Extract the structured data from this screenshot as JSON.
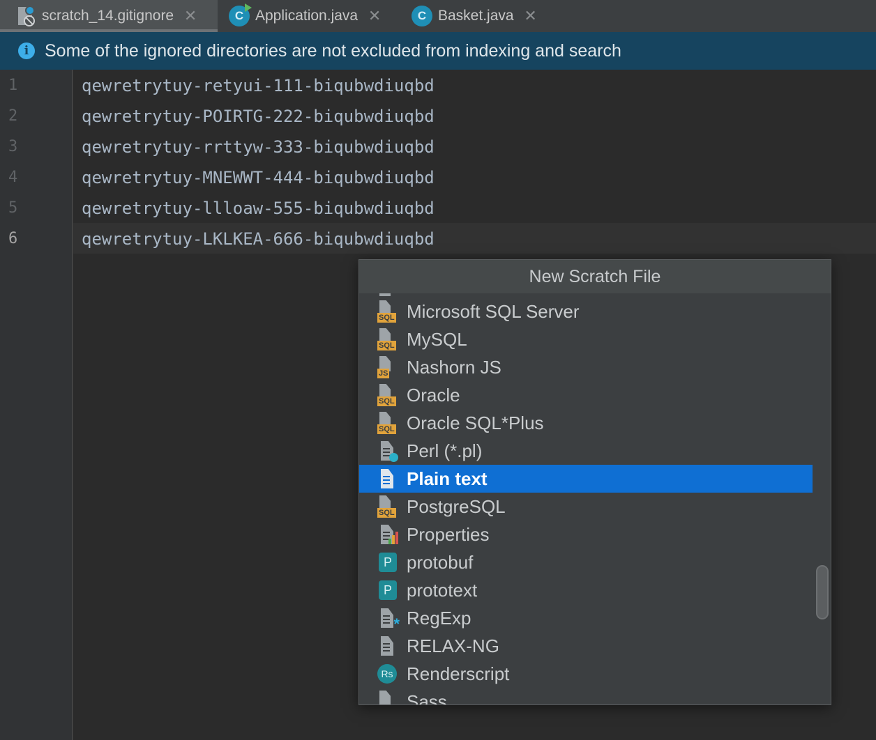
{
  "tabs": [
    {
      "label": "scratch_14.gitignore",
      "icon": "gitignore-file-icon",
      "active": true
    },
    {
      "label": "Application.java",
      "icon": "java-class-run-icon",
      "active": false
    },
    {
      "label": "Basket.java",
      "icon": "java-class-icon",
      "active": false
    }
  ],
  "class_icon_letter": "C",
  "notification": {
    "icon_glyph": "i",
    "text": "Some of the ignored directories are not excluded from indexing and search"
  },
  "editor": {
    "line_numbers": [
      "1",
      "2",
      "3",
      "4",
      "5",
      "6"
    ],
    "lines": [
      "qewretrytuy-retyui-111-biqubwdiuqbd",
      "qewretrytuy-POIRTG-222-biqubwdiuqbd",
      "qewretrytuy-rrttyw-333-biqubwdiuqbd",
      "qewretrytuy-MNEWWT-444-biqubwdiuqbd",
      "qewretrytuy-llloaw-555-biqubwdiuqbd",
      "qewretrytuy-LKLKEA-666-biqubwdiuqbd"
    ],
    "current_line": "6"
  },
  "popup": {
    "title": "New Scratch File",
    "items": [
      {
        "label": "Microsoft SQL Server",
        "icon": "sql-file-icon",
        "badge": "SQL"
      },
      {
        "label": "MySQL",
        "icon": "sql-file-icon",
        "badge": "SQL"
      },
      {
        "label": "Nashorn JS",
        "icon": "js-file-icon",
        "badge": "JS"
      },
      {
        "label": "Oracle",
        "icon": "sql-file-icon",
        "badge": "SQL"
      },
      {
        "label": "Oracle SQL*Plus",
        "icon": "sql-file-icon",
        "badge": "SQL"
      },
      {
        "label": "Perl (*.pl)",
        "icon": "perl-file-icon"
      },
      {
        "label": "Plain text",
        "icon": "text-file-icon",
        "selected": true
      },
      {
        "label": "PostgreSQL",
        "icon": "sql-file-icon",
        "badge": "SQL"
      },
      {
        "label": "Properties",
        "icon": "properties-file-icon"
      },
      {
        "label": "protobuf",
        "icon": "protobuf-icon",
        "badge": "P"
      },
      {
        "label": "prototext",
        "icon": "prototext-icon",
        "badge": "P"
      },
      {
        "label": "RegExp",
        "icon": "regexp-file-icon"
      },
      {
        "label": "RELAX-NG",
        "icon": "relaxng-file-icon"
      },
      {
        "label": "Renderscript",
        "icon": "renderscript-icon",
        "badge": "Rs"
      },
      {
        "label": "Sass",
        "icon": "sass-file-icon"
      }
    ]
  },
  "colors": {
    "selection": "#0f6fd3",
    "notification_bg": "#16445f",
    "sql_badge": "#e1a33b",
    "teal_badge": "#1f8c96"
  }
}
